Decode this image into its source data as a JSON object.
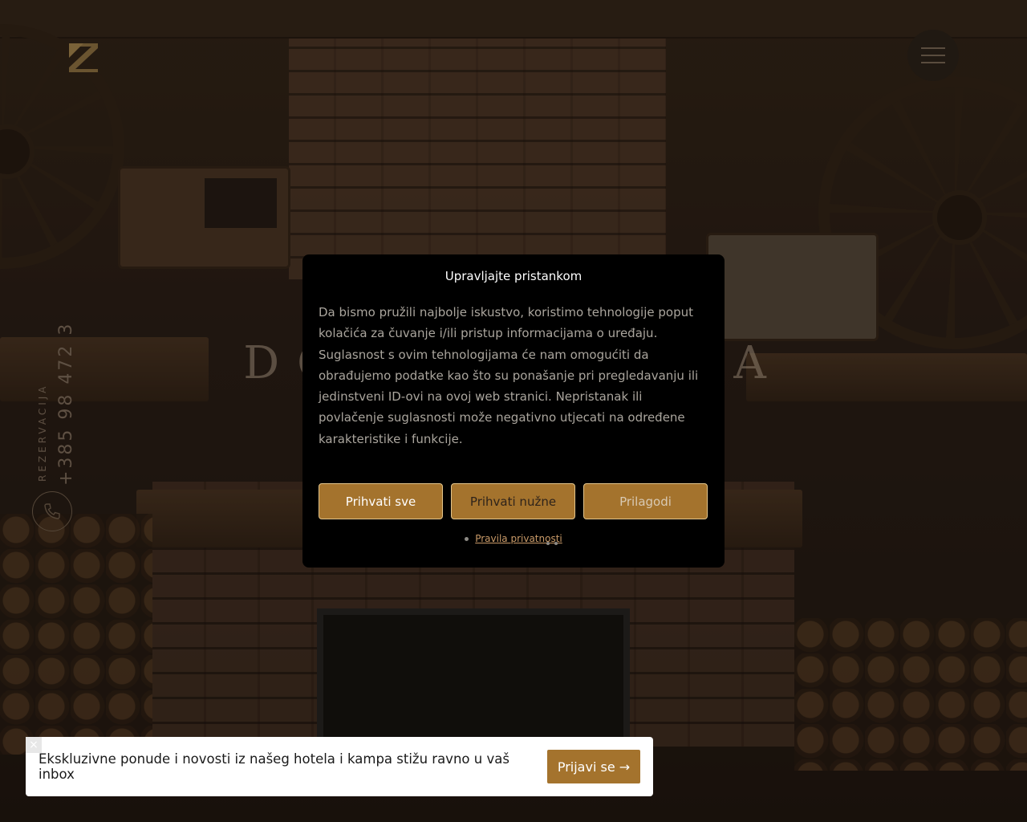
{
  "header": {
    "logo_icon": "z-logo-icon",
    "menu_icon": "hamburger-menu-icon",
    "accent_color": "#a4732d"
  },
  "hero": {
    "title": "DOBRODOŠLI U BISTROU ZVIJEZDA",
    "visible_left": "DO",
    "visible_right": "TA"
  },
  "reservation": {
    "label": "REZERVACIJA",
    "phone": "+385 98 472 3",
    "phone_icon": "phone-icon"
  },
  "consent_modal": {
    "title": "Upravljajte pristankom",
    "text": "Da bismo pružili najbolje iskustvo, koristimo tehnologije poput kolačića za čuvanje i/ili pristup informacijama o uređaju. Suglasnost s ovim tehnologijama će nam omogućiti da obrađujemo podatke kao što su ponašanje pri pregledavanju ili jedinstveni ID-ovi na ovoj web stranici. Nepristanak ili povlačenje suglasnosti može negativno utjecati na određene karakteristike i funkcije.",
    "accept_all": "Prihvati sve",
    "accept_necessary": "Prihvati nužne",
    "customize": "Prilagodi",
    "privacy_link": "Pravila privatnosti"
  },
  "newsletter": {
    "close_label": "×",
    "text": "Ekskluzivne ponude i novosti iz našeg hotela i kampa stižu ravno u vaš inbox",
    "button": "Prijavi se →"
  }
}
